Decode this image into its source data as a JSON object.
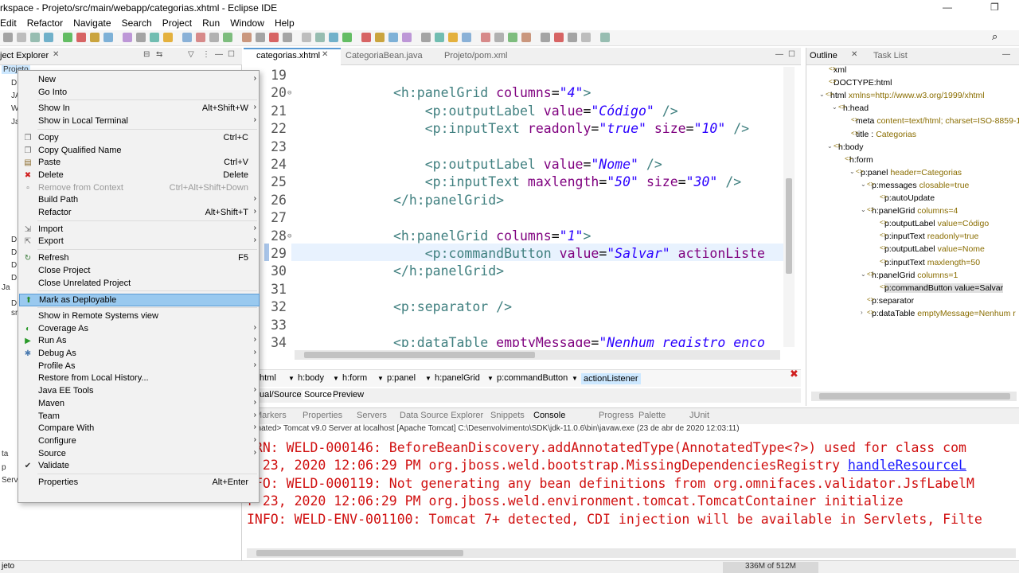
{
  "window": {
    "title": "rkspace - Projeto/src/main/webapp/categorias.xhtml - Eclipse IDE",
    "min": "—",
    "max": "❐"
  },
  "menubar": [
    "Edit",
    "Refactor",
    "Navigate",
    "Search",
    "Project",
    "Run",
    "Window",
    "Help"
  ],
  "explorer": {
    "tab": "ject Explorer",
    "root": "Projeto",
    "stubs": [
      "D",
      "JA",
      "W",
      "Ja",
      "D",
      "D",
      "D",
      "D",
      "D",
      "Ja",
      "sr",
      "ta",
      "p",
      "Serv"
    ]
  },
  "editor": {
    "tabs": [
      "categorias.xhtml",
      "CategoriaBean.java",
      "Projeto/pom.xml"
    ],
    "breadcrumbs": [
      "html",
      "h:body",
      "h:form",
      "p:panel",
      "h:panelGrid",
      "p:commandButton",
      "actionListener"
    ],
    "view_tabs": [
      "ual/Source",
      "Source",
      "Preview"
    ]
  },
  "code": [
    {
      "n": "19",
      "t": ""
    },
    {
      "n": "20",
      "t": "<h:panelGrid columns=\"4\">"
    },
    {
      "n": "21",
      "t": "    <p:outputLabel value=\"Código\" />"
    },
    {
      "n": "22",
      "t": "    <p:inputText readonly=\"true\" size=\"10\" />"
    },
    {
      "n": "23",
      "t": ""
    },
    {
      "n": "24",
      "t": "    <p:outputLabel value=\"Nome\" />"
    },
    {
      "n": "25",
      "t": "    <p:inputText maxlength=\"50\" size=\"30\" />"
    },
    {
      "n": "26",
      "t": "</h:panelGrid>"
    },
    {
      "n": "27",
      "t": ""
    },
    {
      "n": "28",
      "t": "<h:panelGrid columns=\"1\">"
    },
    {
      "n": "29",
      "t": "    <p:commandButton value=\"Salvar\" actionListe"
    },
    {
      "n": "30",
      "t": "</h:panelGrid>"
    },
    {
      "n": "31",
      "t": ""
    },
    {
      "n": "32",
      "t": "<p:separator />"
    },
    {
      "n": "33",
      "t": ""
    },
    {
      "n": "34",
      "t": "<p:dataTable emptyMessage=\"Nenhum registro enco"
    }
  ],
  "outline": {
    "tabs": [
      "Outline",
      "Task List"
    ],
    "nodes": [
      {
        "n": "xml",
        "a": ""
      },
      {
        "n": "DOCTYPE:html",
        "a": ""
      },
      {
        "n": "html",
        "a": "xmlns=http://www.w3.org/1999/xhtml"
      },
      {
        "n": "h:head",
        "a": ""
      },
      {
        "n": "meta",
        "a": "content=text/html; charset=ISO-8859-1"
      },
      {
        "n": "title :",
        "a": "Categorias"
      },
      {
        "n": "h:body",
        "a": ""
      },
      {
        "n": "h:form",
        "a": ""
      },
      {
        "n": "p:panel",
        "a": "header=Categorias"
      },
      {
        "n": "p:messages",
        "a": "closable=true"
      },
      {
        "n": "p:autoUpdate",
        "a": ""
      },
      {
        "n": "h:panelGrid",
        "a": "columns=4"
      },
      {
        "n": "p:outputLabel",
        "a": "value=Código"
      },
      {
        "n": "p:inputText",
        "a": "readonly=true"
      },
      {
        "n": "p:outputLabel",
        "a": "value=Nome"
      },
      {
        "n": "p:inputText",
        "a": "maxlength=50"
      },
      {
        "n": "h:panelGrid",
        "a": "columns=1"
      },
      {
        "n": "p:commandButton value=Salvar",
        "a": ""
      },
      {
        "n": "p:separator",
        "a": ""
      },
      {
        "n": "p:dataTable",
        "a": "emptyMessage=Nenhum r"
      }
    ]
  },
  "console": {
    "tabs": [
      "Markers",
      "Properties",
      "Servers",
      "Data Source Explorer",
      "Snippets",
      "Console",
      "Progress",
      "Palette",
      "JUnit"
    ],
    "description": "minated> Tomcat v9.0 Server at localhost [Apache Tomcat] C:\\Desenvolvimento\\SDK\\jdk-11.0.6\\bin\\javaw.exe (23 de abr de 2020 12:03:11)",
    "lines": [
      "ARN: WELD-000146: BeforeBeanDiscovery.addAnnotatedType(AnnotatedType<?>) used for class com",
      "r 23, 2020 12:06:29 PM org.jboss.weld.bootstrap.MissingDependenciesRegistry ",
      "NFO: WELD-000119: Not generating any bean definitions from org.omnifaces.validator.JsfLabelM",
      "r 23, 2020 12:06:29 PM org.jboss.weld.environment.tomcat.TomcatContainer initialize",
      "INFO: WELD-ENV-001100: Tomcat 7+ detected, CDI injection will be available in Servlets, Filte"
    ],
    "link": "handleResourceL"
  },
  "status": {
    "left": "jeto",
    "heap": "336M of 512M"
  },
  "context_menu": [
    {
      "label": "New",
      "acc": "",
      "sub": true
    },
    {
      "label": "Go Into",
      "acc": ""
    },
    {
      "sep": true
    },
    {
      "label": "Show In",
      "acc": "Alt+Shift+W",
      "sub": true
    },
    {
      "label": "Show in Local Terminal",
      "acc": "",
      "sub": true
    },
    {
      "sep": true
    },
    {
      "label": "Copy",
      "acc": "Ctrl+C",
      "icon": "copy-icon"
    },
    {
      "label": "Copy Qualified Name",
      "acc": "",
      "icon": "copy-qualified-icon"
    },
    {
      "label": "Paste",
      "acc": "Ctrl+V",
      "icon": "paste-icon"
    },
    {
      "label": "Delete",
      "acc": "Delete",
      "icon": "delete-icon"
    },
    {
      "label": "Remove from Context",
      "acc": "Ctrl+Alt+Shift+Down",
      "disabled": true,
      "icon": "remove-context-icon"
    },
    {
      "label": "Build Path",
      "acc": "",
      "sub": true
    },
    {
      "label": "Refactor",
      "acc": "Alt+Shift+T",
      "sub": true
    },
    {
      "sep": true
    },
    {
      "label": "Import",
      "acc": "",
      "sub": true,
      "icon": "import-icon"
    },
    {
      "label": "Export",
      "acc": "",
      "sub": true,
      "icon": "export-icon"
    },
    {
      "sep": true
    },
    {
      "label": "Refresh",
      "acc": "F5",
      "icon": "refresh-icon"
    },
    {
      "label": "Close Project",
      "acc": ""
    },
    {
      "label": "Close Unrelated Project",
      "acc": ""
    },
    {
      "sep": true
    },
    {
      "label": "Mark as Deployable",
      "acc": "",
      "highlight": true,
      "icon": "deployable-icon"
    },
    {
      "sep": true
    },
    {
      "label": "Show in Remote Systems view",
      "acc": ""
    },
    {
      "label": "Coverage As",
      "acc": "",
      "sub": true,
      "icon": "coverage-icon"
    },
    {
      "label": "Run As",
      "acc": "",
      "sub": true,
      "icon": "run-icon"
    },
    {
      "label": "Debug As",
      "acc": "",
      "sub": true,
      "icon": "debug-icon"
    },
    {
      "label": "Profile As",
      "acc": "",
      "sub": true
    },
    {
      "label": "Restore from Local History...",
      "acc": ""
    },
    {
      "label": "Java EE Tools",
      "acc": "",
      "sub": true
    },
    {
      "label": "Maven",
      "acc": "",
      "sub": true
    },
    {
      "label": "Team",
      "acc": "",
      "sub": true
    },
    {
      "label": "Compare With",
      "acc": "",
      "sub": true
    },
    {
      "label": "Configure",
      "acc": "",
      "sub": true
    },
    {
      "label": "Source",
      "acc": "",
      "sub": true
    },
    {
      "label": "Validate",
      "acc": "",
      "check": true
    },
    {
      "sep": true
    },
    {
      "label": "Properties",
      "acc": "Alt+Enter"
    }
  ]
}
